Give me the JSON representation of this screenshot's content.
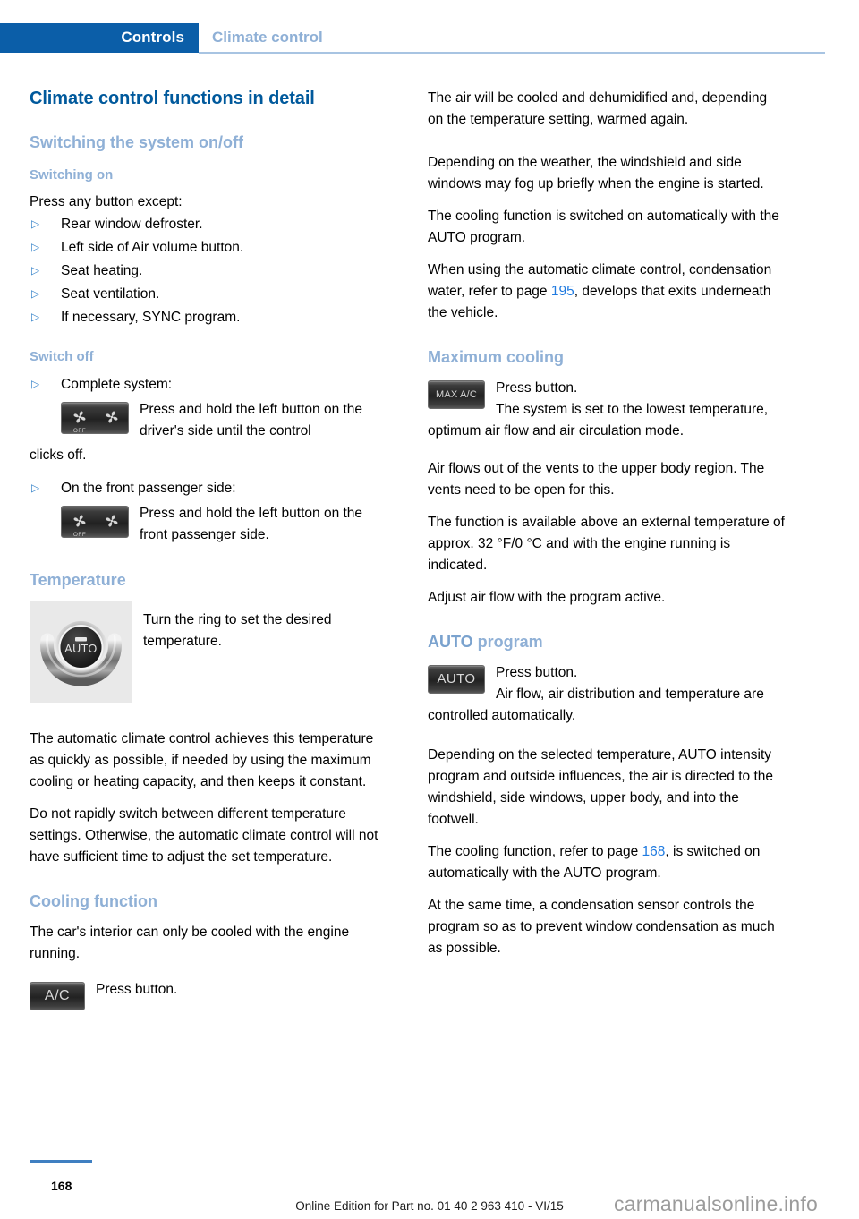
{
  "header": {
    "tab_label": "Controls",
    "section_label": "Climate control",
    "tab_color": "#0b5ea8",
    "section_color": "#8fb0d6"
  },
  "left_column": {
    "title": "Climate control functions in detail",
    "section_on_off": "Switching the system on/off",
    "sub_switching_on": "Switching on",
    "press_any_button": "Press any button except:",
    "exceptions": [
      "Rear window defroster.",
      "Left side of Air volume button.",
      "Seat heating.",
      "Seat ventilation.",
      "If necessary, SYNC program."
    ],
    "sub_switch_off": "Switch off",
    "switch_off_item_1": "Complete system:",
    "off_button_1_text": "Press and hold the left button on the driver's side until the control",
    "off_button_1_cont": "clicks off.",
    "switch_off_item_2": "On the front passenger side:",
    "off_button_2_text": "Press and hold the left button on the front passenger side.",
    "section_temperature": "Temperature",
    "dial_caption": "Turn the ring to set the desired temperature.",
    "dial_center_label": "AUTO",
    "para_1": "The automatic climate control achieves this temperature as quickly as possible, if needed by using the maximum cooling or heating capacity, and then keeps it constant.",
    "para_2": "Do not rapidly switch between different temperature settings. Otherwise, the automatic climate control will not have sufficient time to adjust the set temperature.",
    "section_cooling": "Cooling function",
    "para_3": "The car's interior can only be cooled with the engine running.",
    "ac_button_label": "A/C",
    "ac_press": "Press button.",
    "off_button_label": "OFF"
  },
  "right_column": {
    "para_1": "The air will be cooled and dehumidified and, depending on the temperature setting, warmed again.",
    "para_2": "Depending on the weather, the windshield and side windows may fog up briefly when the engine is started.",
    "para_3": "The cooling function is switched on automatically with the AUTO program.",
    "para_4_before": "When using the automatic climate control, condensation water, refer to page ",
    "para_4_xref": "195",
    "para_4_after": ", develops that exits underneath the vehicle.",
    "section_max_cooling": "Maximum cooling",
    "max_ac_button_label": "MAX A/C",
    "max_ac_press": "Press button.",
    "max_ac_desc": "The system is set to the lowest temperature, optimum air flow and air circulation mode.",
    "para_5": "Air flows out of the vents to the upper body region. The vents need to be open for this.",
    "para_6": "The function is available above an external temperature of approx. 32 °F/0 °C and with the engine running is indicated.",
    "para_7": "Adjust air flow with the program active.",
    "section_auto_program_strong": "AUTO",
    "section_auto_program_rest": " program",
    "auto_button_label": "AUTO",
    "auto_press": "Press button.",
    "auto_desc": "Air flow, air distribution and temperature are controlled automatically.",
    "para_8": "Depending on the selected temperature, AUTO intensity program and outside influences, the air is directed to the windshield, side windows, upper body, and into the footwell.",
    "para_9_before": "The cooling function, refer to page ",
    "para_9_xref": "168",
    "para_9_after": ", is switched on automatically with the AUTO program.",
    "para_10": "At the same time, a condensation sensor controls the program so as to prevent window condensation as much as possible.",
    "xref_color": "#1f7ae0"
  },
  "footer": {
    "page_number": "168",
    "edition_line": "Online Edition for Part no. 01 40 2 963 410 - VI/15",
    "watermark": "carmanualsonline.info"
  },
  "icons": {
    "bullet": "▷"
  }
}
